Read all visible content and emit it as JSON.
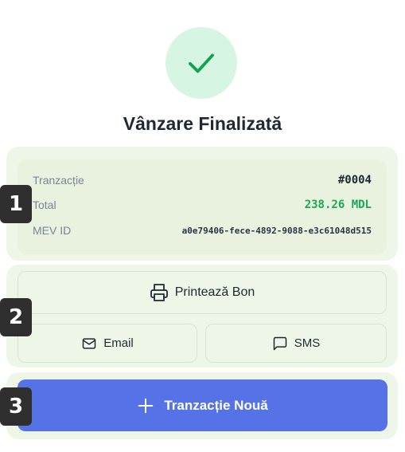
{
  "status": {
    "title": "Vânzare Finalizată",
    "icon": "check-icon",
    "accent": "#18a957"
  },
  "transaction": {
    "tranzactie_label": "Tranzacție",
    "tranzactie_value": "#0004",
    "total_label": "Total",
    "total_value": "238.26 MDL",
    "mev_label": "MEV ID",
    "mev_value": "a0e79406-fece-4892-9088-e3c61048d515"
  },
  "actions": {
    "print_label": "Printează Bon",
    "print_icon": "printer-icon",
    "email_label": "Email",
    "email_icon": "mail-icon",
    "sms_label": "SMS",
    "sms_icon": "message-icon",
    "new_label": "Tranzacție Nouă",
    "new_icon": "plus-icon",
    "primary_color": "#5572e6"
  },
  "badges": [
    "1",
    "2",
    "3"
  ]
}
